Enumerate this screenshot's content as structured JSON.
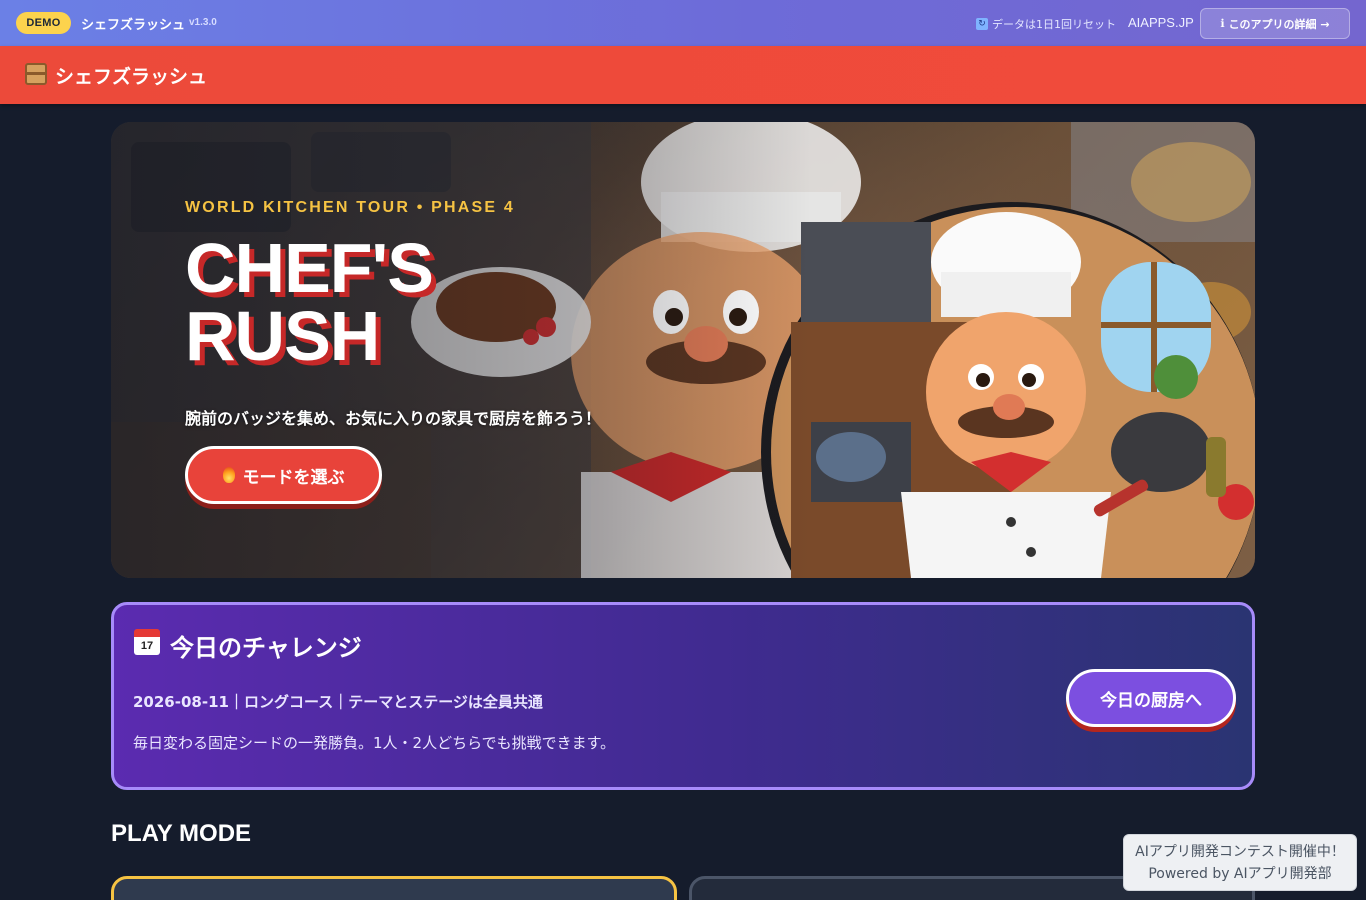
{
  "topbar": {
    "badge": "DEMO",
    "app_name": "シェフズラッシュ",
    "version": "v1.3.0",
    "reset_note": "データは1日1回リセット",
    "site_link": "AIAPPS.JP",
    "details_button": "このアプリの詳細 →"
  },
  "header": {
    "title": "シェフズラッシュ"
  },
  "hero": {
    "eyebrow": "WORLD KITCHEN TOUR • PHASE 4",
    "title_line1": "CHEF'S",
    "title_line2": "RUSH",
    "subtitle": "腕前のバッジを集め、お気に入りの家具で厨房を飾ろう！",
    "cta_label": "モードを選ぶ"
  },
  "challenge": {
    "icon_text": "17",
    "title": "今日のチャレンジ",
    "meta": "2026-08-11｜ロングコース｜テーマとステージは全員共通",
    "description": "毎日変わる固定シードの一発勝負。1人・2人どちらでも挑戦できます。",
    "button_label": "今日の厨房へ"
  },
  "play_mode": {
    "title": "PLAY MODE"
  },
  "powered": {
    "line1": "AIアプリ開発コンテスト開催中！",
    "line2": "Powered by AIアプリ開発部"
  },
  "colors": {
    "accent_red": "#e8433a",
    "accent_gold": "#f6c343",
    "accent_purple": "#a78bfa",
    "page_bg": "#151c2c"
  }
}
